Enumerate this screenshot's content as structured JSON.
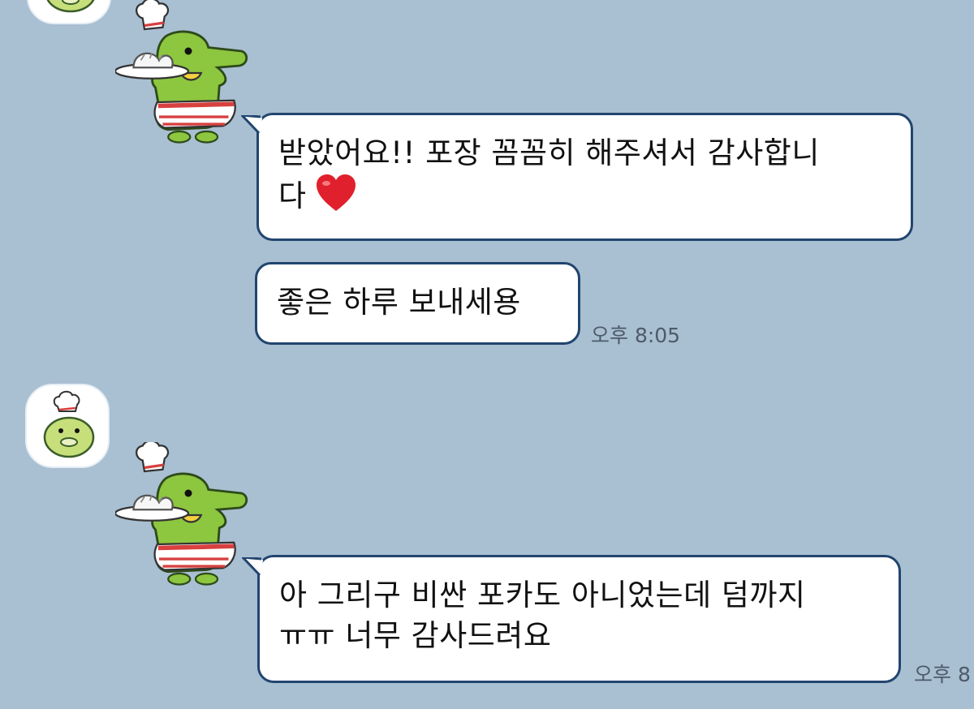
{
  "chat": {
    "messages": [
      {
        "line1": "받았어요!! 포장 꼼꼼히 해주셔서 감사합니",
        "line2": "다"
      },
      {
        "text": "좋은 하루 보내세용",
        "time": "오후 8:05"
      },
      {
        "line1": "아 그리구 비싼 포카도 아니었는데 덤까지",
        "line2": "ㅠㅠ 너무 감사드려요",
        "time": "오후 8"
      }
    ],
    "icons": {
      "avatar": "chef-dumpling-avatar-icon",
      "sticker": "chef-dumpling-sticker",
      "heart": "red-heart-emoji"
    },
    "colors": {
      "background": "#a9bfd2",
      "bubble": "#ffffff",
      "bubble_border": "#21456e",
      "timestamp": "#4d5b6a",
      "heart": "#e0202c"
    }
  }
}
